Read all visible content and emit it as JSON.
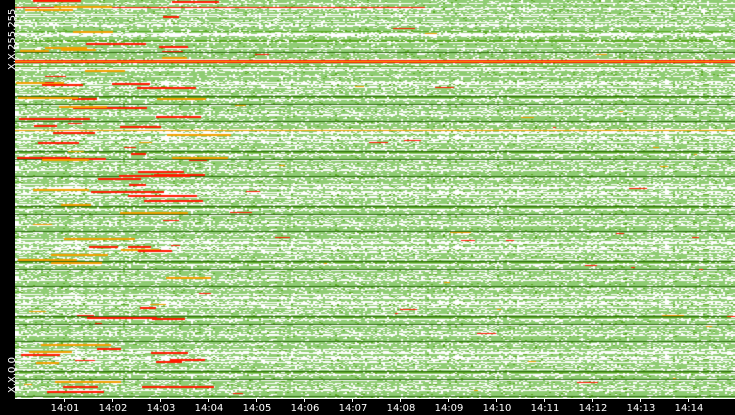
{
  "chart_data": {
    "type": "heatmap",
    "title": "",
    "xlabel": "",
    "ylabel": "",
    "x_ticks": [
      "14:01",
      "14:02",
      "14:03",
      "14:04",
      "14:05",
      "14:06",
      "14:07",
      "14:08",
      "14:09",
      "14:10",
      "14:11",
      "14:12",
      "14:13",
      "14:14"
    ],
    "y_labels": {
      "top": "X.X.255.255",
      "bottom": "X.X.0.0"
    },
    "colors": {
      "empty": "#ffffff",
      "low": "#8fcc73",
      "medium": "#5aa81e",
      "high": "#f0a000",
      "very_high": "#ff1a00",
      "dark": "#2e6b10"
    },
    "grid": false,
    "legend": "none"
  }
}
